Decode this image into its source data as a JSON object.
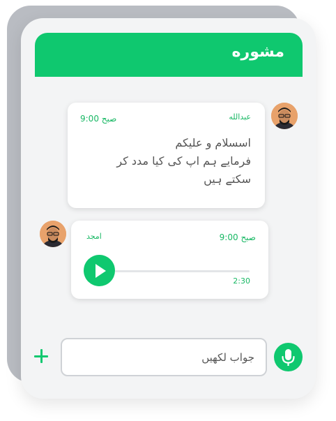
{
  "header": {
    "title": "مشوره"
  },
  "messages": [
    {
      "sender": "عبدالله",
      "time": "صبح 9:00",
      "lines": [
        "اسسلام و علیکم",
        "فرمایے ہم اپ کی کیا مدد کر",
        "سکتے ہیں"
      ]
    },
    {
      "sender": "امجد",
      "time": "صبح 9:00",
      "audio": {
        "duration": "2:30",
        "progress": 0
      }
    }
  ],
  "composer": {
    "placeholder": "جواب لکھیں"
  },
  "icons": {
    "add": "plus-icon",
    "play": "play-icon",
    "mic": "microphone-icon"
  },
  "colors": {
    "accent": "#0fc86f",
    "back_card": "#b9bcc2",
    "surface": "#f3f4f5"
  }
}
